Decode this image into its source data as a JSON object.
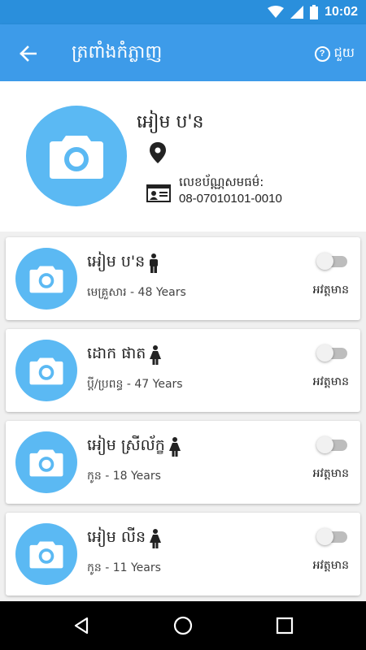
{
  "status_bar": {
    "time": "10:02",
    "icons": [
      "wifi-icon",
      "signal-icon",
      "battery-icon"
    ]
  },
  "app_bar": {
    "title": "ត្រពាំងកំភ្លាញ",
    "help_label": "ជួយ",
    "help_symbol": "?"
  },
  "profile": {
    "name": "អៀម ប'ន",
    "id_label": "លេខប័ណ្ណសមធម៌:",
    "id_value": "08-07010101-0010"
  },
  "members": [
    {
      "name": "អៀម ប'ន",
      "gender": "male",
      "info": "មេគ្រួសារ - 48 Years",
      "toggle_label": "អវត្តមាន",
      "toggle_on": false
    },
    {
      "name": "ដោក ផាត",
      "gender": "female",
      "info": "ប្ដី/ប្រពន្ធ - 47 Years",
      "toggle_label": "អវត្តមាន",
      "toggle_on": false
    },
    {
      "name": "អៀម ស្រីល័ក្ខ",
      "gender": "female",
      "info": "កូន - 18 Years",
      "toggle_label": "អវត្តមាន",
      "toggle_on": false
    },
    {
      "name": "អៀម លីន",
      "gender": "female",
      "info": "កូន - 11 Years",
      "toggle_label": "អវត្តមាន",
      "toggle_on": false
    }
  ],
  "colors": {
    "primary": "#3d9be9",
    "status_bar": "#2a8fdc",
    "avatar": "#5bb9f3",
    "background": "#f0f0f0"
  },
  "nav": {
    "icons": [
      "back-triangle-icon",
      "home-circle-icon",
      "recents-square-icon"
    ]
  }
}
